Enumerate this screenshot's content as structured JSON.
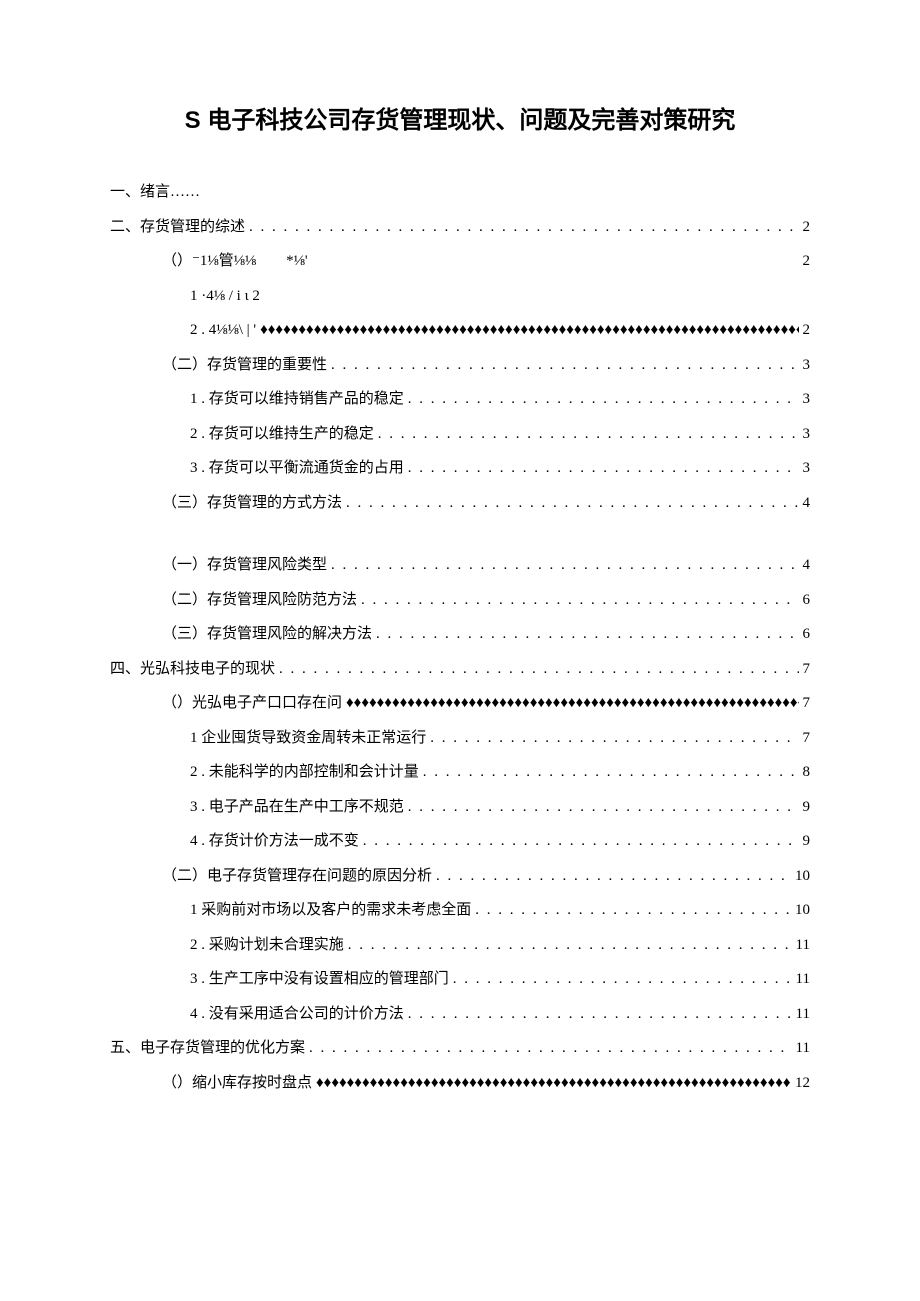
{
  "title": "S 电子科技公司存货管理现状、问题及完善对策研究",
  "toc": [
    {
      "level": 0,
      "label": "一、绪言……",
      "leader": "none",
      "page": ""
    },
    {
      "level": 0,
      "label": "二、存货管理的综述",
      "leader": "dots",
      "page": "2"
    },
    {
      "level": 1,
      "label": "（）⁻1⅛管⅛⅛　　*⅛'",
      "leader": "space",
      "page": "2"
    },
    {
      "level": 2,
      "label": "1 ·4⅛ / i ι 2",
      "leader": "none",
      "page": ""
    },
    {
      "level": 2,
      "label": "2 . 4⅛⅛\\ | '",
      "leader": "diamond",
      "page": "2"
    },
    {
      "level": 1,
      "label": "（二）存货管理的重要性",
      "leader": "dots",
      "page": "3"
    },
    {
      "level": 2,
      "label": "1 . 存货可以维持销售产品的稳定",
      "leader": "dots",
      "page": "3"
    },
    {
      "level": 2,
      "label": "2 . 存货可以维持生产的稳定",
      "leader": "dots",
      "page": "3"
    },
    {
      "level": 2,
      "label": "3 . 存货可以平衡流通货金的占用",
      "leader": "dots",
      "page": "3"
    },
    {
      "level": 1,
      "label": "（三）存货管理的方式方法",
      "leader": "dots",
      "page": "4"
    },
    {
      "level": -1,
      "label": "",
      "leader": "gap",
      "page": ""
    },
    {
      "level": 1,
      "label": "（一）存货管理风险类型",
      "leader": "dots",
      "page": "4"
    },
    {
      "level": 1,
      "label": "（二）存货管理风险防范方法",
      "leader": "dots",
      "page": "6"
    },
    {
      "level": 1,
      "label": "（三）存货管理风险的解决方法",
      "leader": "dots",
      "page": "6"
    },
    {
      "level": 0,
      "label": "四、光弘科技电子的现状",
      "leader": "dots",
      "page": "7"
    },
    {
      "level": 1,
      "label": "（）光弘电子产口口存在问",
      "leader": "diamond",
      "page": "7"
    },
    {
      "level": 2,
      "label": "1 企业囤货导致资金周转未正常运行",
      "leader": "dots",
      "page": "7"
    },
    {
      "level": 2,
      "label": "2 . 未能科学的内部控制和会计计量",
      "leader": "dots",
      "page": "8"
    },
    {
      "level": 2,
      "label": "3 . 电子产品在生产中工序不规范",
      "leader": "dots",
      "page": "9"
    },
    {
      "level": 2,
      "label": "4 . 存货计价方法一成不变",
      "leader": "dots",
      "page": "9"
    },
    {
      "level": 1,
      "label": "（二）电子存货管理存在问题的原因分析",
      "leader": "dots",
      "page": "10"
    },
    {
      "level": 2,
      "label": "1 采购前对市场以及客户的需求未考虑全面",
      "leader": "dots",
      "page": "10"
    },
    {
      "level": 2,
      "label": "2 . 采购计划未合理实施",
      "leader": "dots",
      "page": "11"
    },
    {
      "level": 2,
      "label": "3 . 生产工序中没有设置相应的管理部门",
      "leader": "dots",
      "page": "11"
    },
    {
      "level": 2,
      "label": "4 . 没有采用适合公司的计价方法",
      "leader": "dots",
      "page": "11"
    },
    {
      "level": 0,
      "label": "五、电子存货管理的优化方案",
      "leader": "dots",
      "page": "11"
    },
    {
      "level": 1,
      "label": "（）缩小库存按时盘点",
      "leader": "diamond",
      "page": "12"
    }
  ]
}
